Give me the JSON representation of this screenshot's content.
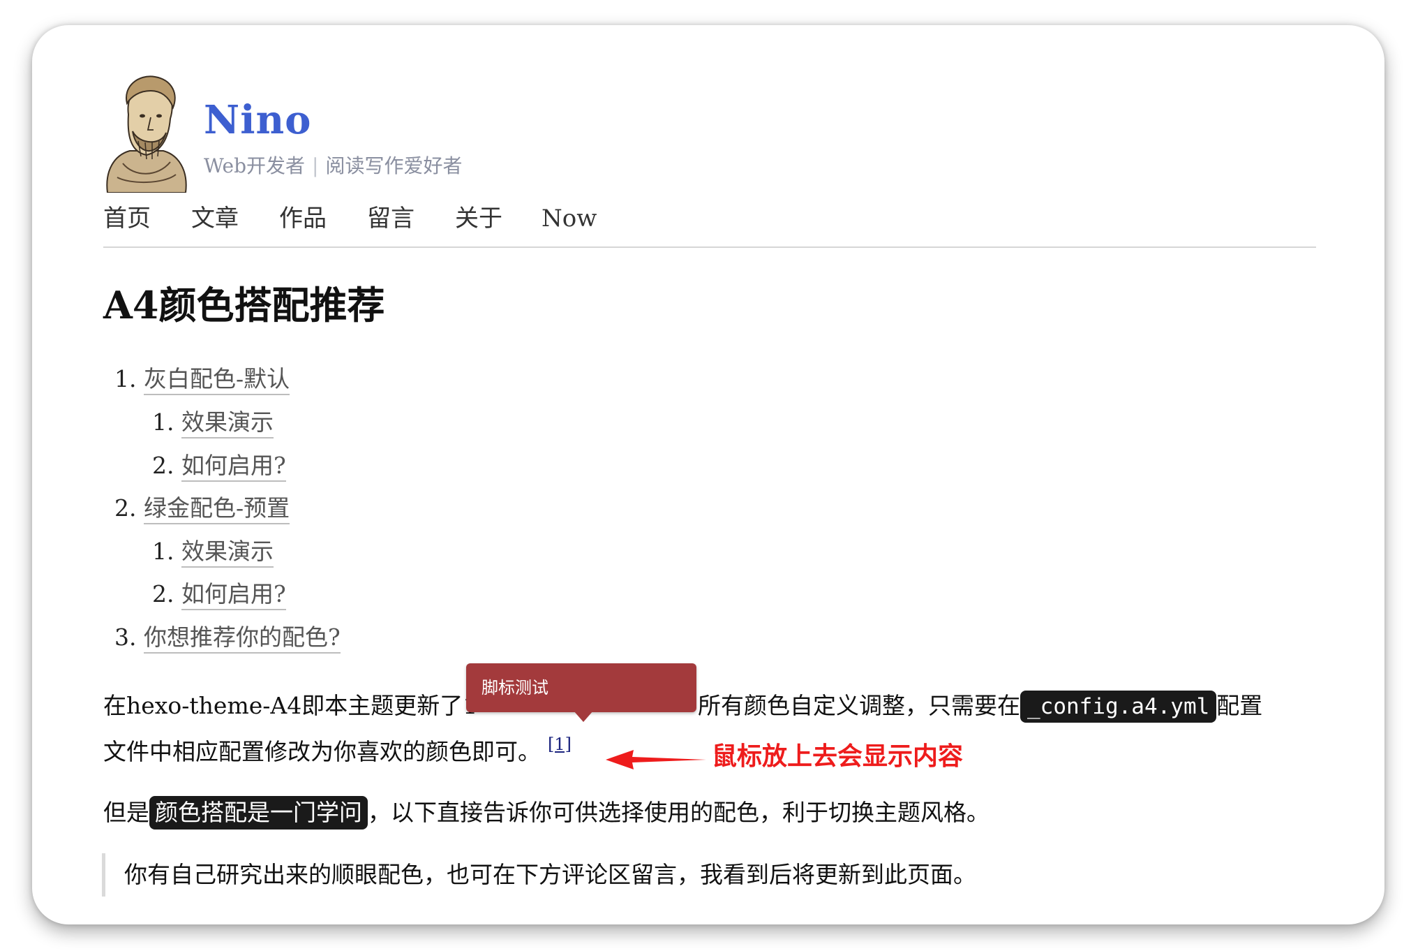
{
  "site": {
    "title": "Nino",
    "subtitle_left": "Web开发者",
    "subtitle_sep": "|",
    "subtitle_right": "阅读写作爱好者"
  },
  "nav": {
    "items": [
      {
        "label": "首页"
      },
      {
        "label": "文章"
      },
      {
        "label": "作品"
      },
      {
        "label": "留言"
      },
      {
        "label": "关于"
      },
      {
        "label": "Now"
      }
    ]
  },
  "post": {
    "title": "A4颜色搭配推荐",
    "toc": [
      {
        "num": "1.",
        "label": "灰白配色-默认"
      },
      {
        "num": "1.",
        "label": "效果演示"
      },
      {
        "num": "2.",
        "label": "如何启用?"
      },
      {
        "num": "2.",
        "label": "绿金配色-预置"
      },
      {
        "num": "1.",
        "label": "效果演示"
      },
      {
        "num": "2.",
        "label": "如何启用?"
      },
      {
        "num": "3.",
        "label": "你想推荐你的配色?"
      }
    ],
    "para1": {
      "pre": "在hexo-theme-A4即本主题更新了1",
      "mid": "所有颜色自定义调整，只需要在",
      "code": "_config.a4.yml",
      "post": "配置",
      "line2": "文件中相应配置修改为你喜欢的颜色即可。",
      "footnote": "[1]"
    },
    "para2": {
      "pre": "但是",
      "highlight": "颜色搭配是一门学问",
      "post": "，以下直接告诉你可供选择使用的配色，利于切换主题风格。"
    },
    "quote": "你有自己研究出来的顺眼配色，也可在下方评论区留言，我看到后将更新到此页面。"
  },
  "tooltip": {
    "text": "脚标测试"
  },
  "annotation": {
    "text": "鼠标放上去会显示内容",
    "color": "#ee1c1c"
  },
  "colors": {
    "title_blue": "#3d5fd0",
    "tooltip_red": "#a33a3c"
  }
}
